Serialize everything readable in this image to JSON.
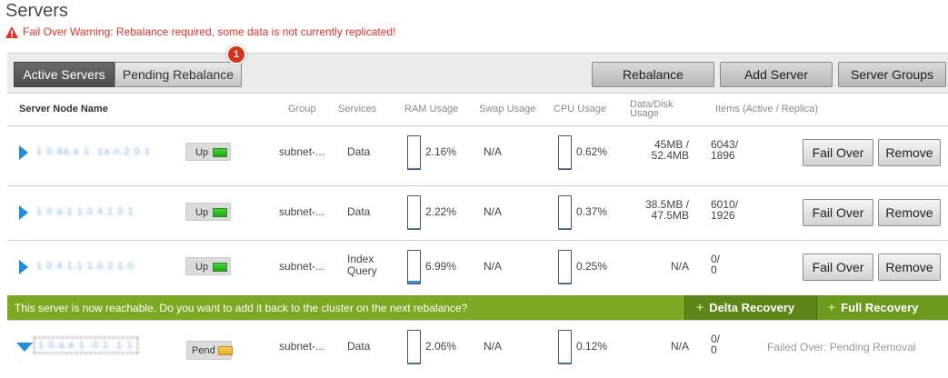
{
  "page": {
    "title": "Servers",
    "warning": "Fail Over Warning: Rebalance required, some data is not currently replicated!"
  },
  "colors": {
    "warning": "#e0322b",
    "accent": "#1f8ee0",
    "banner": "#7da923",
    "badge": "#d9301f"
  },
  "toolbar": {
    "tab_active": "Active Servers",
    "tab_pending": "Pending Rebalance",
    "pending_badge": "1",
    "rebalance": "Rebalance",
    "add_server": "Add Server",
    "server_groups": "Server Groups"
  },
  "headers": {
    "name": "Server Node Name",
    "group": "Group",
    "services": "Services",
    "ram": "RAM Usage",
    "swap": "Swap Usage",
    "cpu": "CPU Usage",
    "disk_1": "Data/Disk",
    "disk_2": "Usage",
    "items": "Items (Active / Replica)"
  },
  "rows": [
    {
      "name": "1 0.4a.e 1 .1a.n.2.0 1",
      "status": "Up",
      "status_color": "green",
      "group": "subnet-...",
      "services_1": "Data",
      "services_2": "",
      "ram": "2.16%",
      "ram_fill": 0.0216,
      "swap": "N/A",
      "cpu": "0.62%",
      "cpu_fill": 0.0062,
      "disk_1": "45MB /",
      "disk_2": "52.4MB",
      "items_1": "6043/",
      "items_2": "1896",
      "fail_over": "Fail Over",
      "remove": "Remove"
    },
    {
      "name": "1 0.a.1 1.0 4.1 0.1",
      "status": "Up",
      "status_color": "green",
      "group": "subnet-...",
      "services_1": "Data",
      "services_2": "",
      "ram": "2.22%",
      "ram_fill": 0.0222,
      "swap": "N/A",
      "cpu": "0.37%",
      "cpu_fill": 0.0037,
      "disk_1": "38.5MB /",
      "disk_2": "47.5MB",
      "items_1": "6010/",
      "items_2": "1926",
      "fail_over": "Fail Over",
      "remove": "Remove"
    },
    {
      "name": "1 0.4 1.1 1.0.2 1.0",
      "status": "Up",
      "status_color": "green",
      "group": "subnet-...",
      "services_1": "Index",
      "services_2": "Query",
      "ram": "6.99%",
      "ram_fill": 0.0699,
      "swap": "N/A",
      "cpu": "0.25%",
      "cpu_fill": 0.0025,
      "disk_1": "N/A",
      "disk_2": "",
      "items_1": "0/",
      "items_2": "0",
      "fail_over": "Fail Over",
      "remove": "Remove"
    },
    {
      "name": "1 0.a.e 1 .0.1 .1 1",
      "status": "Pend",
      "status_color": "yellow",
      "group": "subnet-...",
      "services_1": "Data",
      "services_2": "",
      "ram": "2.06%",
      "ram_fill": 0.0206,
      "swap": "N/A",
      "cpu": "0.12%",
      "cpu_fill": 0.0012,
      "disk_1": "N/A",
      "disk_2": "",
      "items_1": "0/",
      "items_2": "0",
      "note": "Failed Over: Pending Removal"
    }
  ],
  "banner": {
    "message": "This server is now reachable. Do you want to add it back to the cluster on the next rebalance?",
    "delta": "Delta Recovery",
    "full": "Full Recovery",
    "plus": "+"
  }
}
